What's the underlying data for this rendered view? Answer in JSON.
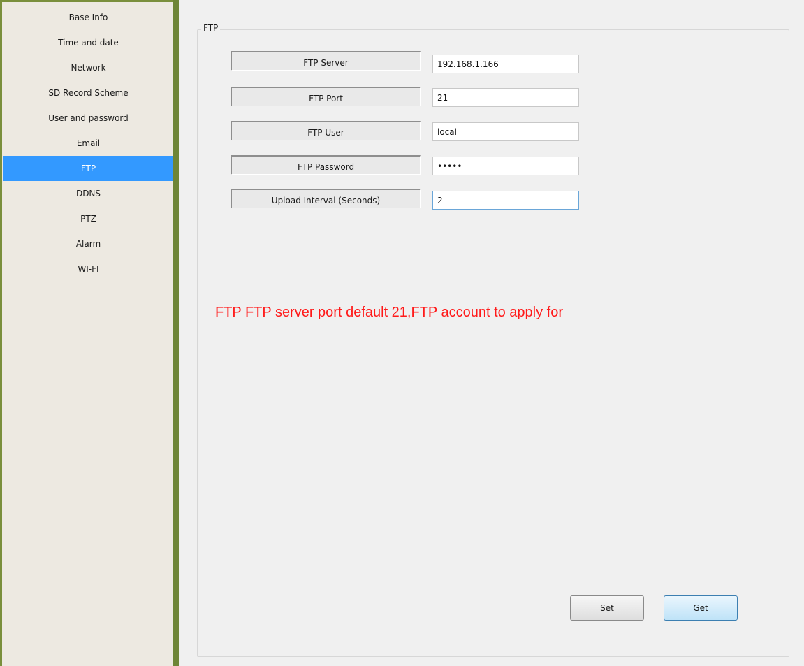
{
  "sidebar": {
    "items": [
      {
        "label": "Base Info"
      },
      {
        "label": "Time and date"
      },
      {
        "label": "Network"
      },
      {
        "label": "SD Record Scheme"
      },
      {
        "label": "User and password"
      },
      {
        "label": "Email"
      },
      {
        "label": "FTP",
        "active": true
      },
      {
        "label": "DDNS"
      },
      {
        "label": "PTZ"
      },
      {
        "label": "Alarm"
      },
      {
        "label": "WI-FI"
      }
    ]
  },
  "group": {
    "title": "FTP"
  },
  "fields": [
    {
      "label": "FTP Server",
      "value": "192.168.1.166"
    },
    {
      "label": "FTP Port",
      "value": "21"
    },
    {
      "label": "FTP User",
      "value": "local"
    },
    {
      "label": "FTP Password",
      "value": "•••••"
    },
    {
      "label": "Upload Interval (Seconds)",
      "value": "2"
    }
  ],
  "note": "FTP FTP server port default 21,FTP account to apply for",
  "buttons": {
    "set": "Set",
    "get": "Get"
  },
  "colors": {
    "frame": "#6e8537",
    "active_item": "#3399ff",
    "note_text": "#ff1a1a"
  }
}
